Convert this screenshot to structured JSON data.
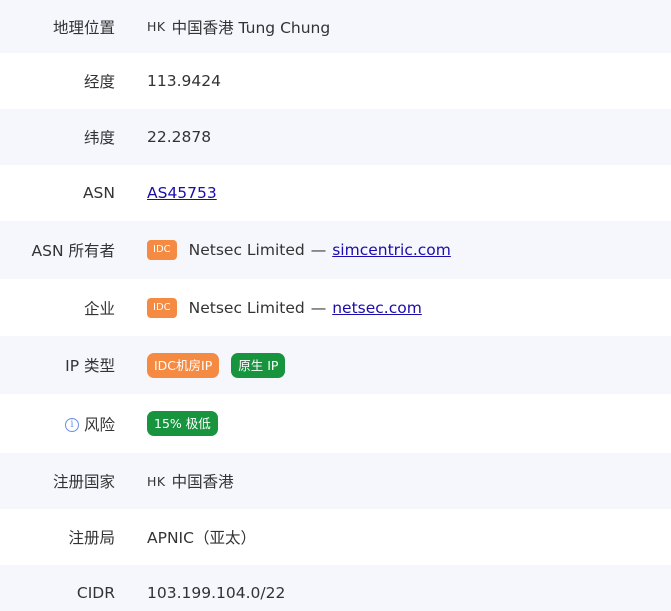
{
  "rows": {
    "location": {
      "label": "地理位置",
      "cc": "HK",
      "value": "中国香港 Tung Chung"
    },
    "longitude": {
      "label": "经度",
      "value": "113.9424"
    },
    "latitude": {
      "label": "纬度",
      "value": "22.2878"
    },
    "asn": {
      "label": "ASN",
      "value": "AS45753"
    },
    "asn_owner": {
      "label": "ASN 所有者",
      "badge": "IDC",
      "name": "Netsec Limited",
      "sep": "—",
      "domain": "simcentric.com"
    },
    "company": {
      "label": "企业",
      "badge": "IDC",
      "name": "Netsec Limited",
      "sep": "—",
      "domain": "netsec.com"
    },
    "ip_type": {
      "label": "IP 类型",
      "tags": [
        "IDC机房IP",
        "原生 IP"
      ]
    },
    "risk": {
      "label": "风险",
      "icon": "info-icon",
      "value": "15% 极低"
    },
    "reg_country": {
      "label": "注册国家",
      "cc": "HK",
      "value": "中国香港"
    },
    "registry": {
      "label": "注册局",
      "value": "APNIC（亚太）"
    },
    "cidr": {
      "label": "CIDR",
      "value": "103.199.104.0/22"
    }
  },
  "colors": {
    "row_alt_bg": "#f5f7fd",
    "badge_orange": "#f58a42",
    "badge_green": "#18943f",
    "link": "#1a0dab"
  }
}
